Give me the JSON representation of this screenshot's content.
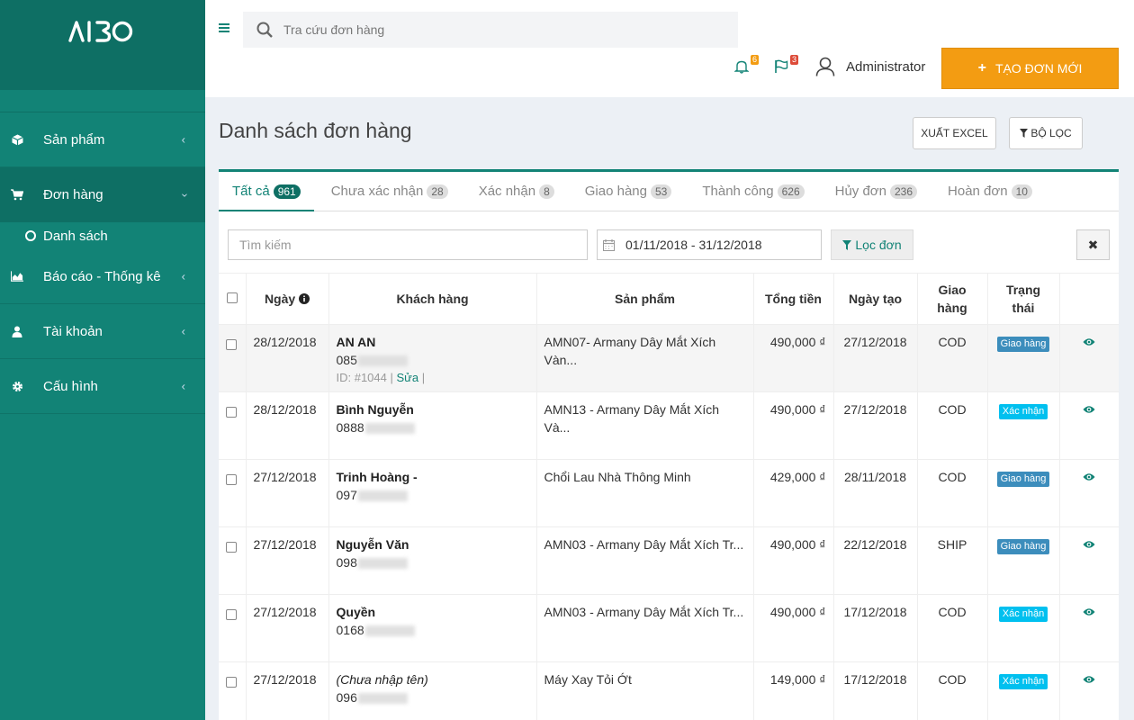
{
  "app": {
    "logo_text": "AIBO"
  },
  "sidebar": {
    "items": [
      {
        "label": "Sản phẩm",
        "icon": "cube-icon"
      },
      {
        "label": "Đơn hàng",
        "icon": "cart-icon"
      },
      {
        "label": "Báo cáo - Thống kê",
        "icon": "area-chart-icon"
      },
      {
        "label": "Tài khoản",
        "icon": "user-icon"
      },
      {
        "label": "Cấu hình",
        "icon": "gear-icon"
      }
    ],
    "submenu": {
      "label": "Danh sách"
    }
  },
  "header": {
    "search_placeholder": "Tra cứu đơn hàng",
    "bell_count": "6",
    "flag_count": "3",
    "user_name": "Administrator",
    "create_label": "TẠO ĐƠN MỚI"
  },
  "page": {
    "title": "Danh sách đơn hàng",
    "export_label": "XUẤT EXCEL",
    "filter_label": "BỘ LỌC"
  },
  "tabs": [
    {
      "label": "Tất cả",
      "count": "961"
    },
    {
      "label": "Chưa xác nhận",
      "count": "28"
    },
    {
      "label": "Xác nhận",
      "count": "8"
    },
    {
      "label": "Giao hàng",
      "count": "53"
    },
    {
      "label": "Thành công",
      "count": "626"
    },
    {
      "label": "Hủy đơn",
      "count": "236"
    },
    {
      "label": "Hoàn đơn",
      "count": "10"
    }
  ],
  "filters": {
    "search_placeholder": "Tìm kiếm",
    "date_range": "01/11/2018 - 31/12/2018",
    "apply_label": "Lọc đơn"
  },
  "table": {
    "headers": {
      "date": "Ngày",
      "customer": "Khách hàng",
      "product": "Sản phẩm",
      "total": "Tổng tiền",
      "created": "Ngày tạo",
      "shipping": "Giao hàng",
      "status": "Trạng thái"
    },
    "rows": [
      {
        "date": "28/12/2018",
        "name": "AN AN",
        "phone": "085",
        "id_text": "ID: #1044 |",
        "edit": "Sửa",
        "sep": "|",
        "product": "AMN07- Armany Dây Mắt Xích Vàn...",
        "total": "490,000 ₫",
        "created": "27/12/2018",
        "shipping": "COD",
        "status": "Giao hàng"
      },
      {
        "date": "28/12/2018",
        "name": "Bình Nguyễn",
        "phone": "0888",
        "product": "AMN13 - Armany Dây Mắt Xích Và...",
        "total": "490,000 ₫",
        "created": "27/12/2018",
        "shipping": "COD",
        "status": "Xác nhận"
      },
      {
        "date": "27/12/2018",
        "name": "Trinh Hoàng -",
        "phone": "097",
        "product": "Chổi Lau Nhà Thông Minh",
        "total": "429,000 ₫",
        "created": "28/11/2018",
        "shipping": "COD",
        "status": "Giao hàng"
      },
      {
        "date": "27/12/2018",
        "name": "Nguyễn Văn",
        "phone": "098",
        "product": "AMN03 - Armany Dây Mắt Xích Tr...",
        "total": "490,000 ₫",
        "created": "22/12/2018",
        "shipping": "SHIP",
        "status": "Giao hàng"
      },
      {
        "date": "27/12/2018",
        "name": "Quyền",
        "phone": "0168",
        "product": "AMN03 - Armany Dây Mắt Xích Tr...",
        "total": "490,000 ₫",
        "created": "17/12/2018",
        "shipping": "COD",
        "status": "Xác nhận"
      },
      {
        "date": "27/12/2018",
        "name": "(Chưa nhập tên)",
        "phone": "096",
        "product": "Máy Xay Tỏi Ớt",
        "total": "149,000 ₫",
        "created": "17/12/2018",
        "shipping": "COD",
        "status": "Xác nhận"
      }
    ]
  },
  "colors": {
    "sidebar": "#128376",
    "accent": "#128376",
    "create_button": "#f39c12",
    "status_giao_hang": "#3c8dbc",
    "status_xac_nhan": "#00c0ef",
    "bell_badge": "#f39c12",
    "flag_badge": "#dd4b39"
  }
}
